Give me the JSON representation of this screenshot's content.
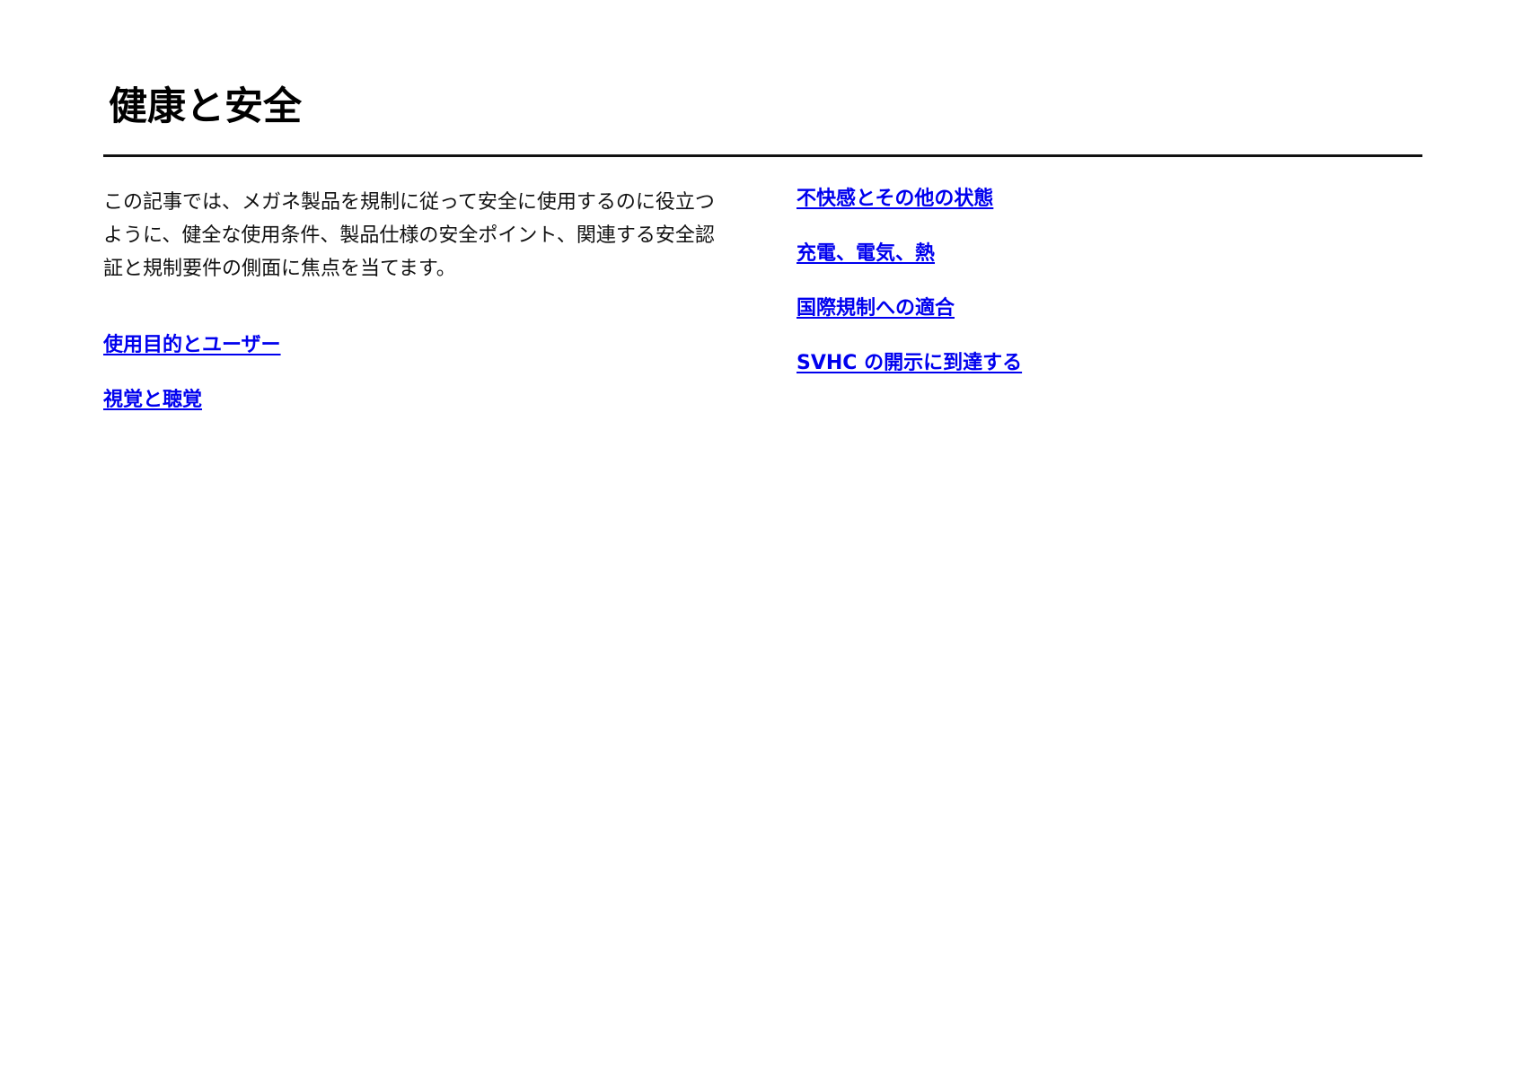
{
  "page": {
    "title": "健康と安全",
    "intro": "この記事では、メガネ製品を規制に従って安全に使用するのに役立つように、健全な使用条件、製品仕様の安全ポイント、関連する安全認証と規制要件の側面に焦点を当てます。"
  },
  "links_left": [
    {
      "label": "使用目的とユーザー"
    },
    {
      "label": "視覚と聴覚"
    }
  ],
  "links_right": [
    {
      "label": "不快感とその他の状態"
    },
    {
      "label": "充電、電気、熱"
    },
    {
      "label": "国際規制への適合"
    },
    {
      "label": "SVHC の開示に到達する"
    }
  ],
  "colors": {
    "link": "#0000ee",
    "text": "#111111",
    "background": "#ffffff"
  }
}
